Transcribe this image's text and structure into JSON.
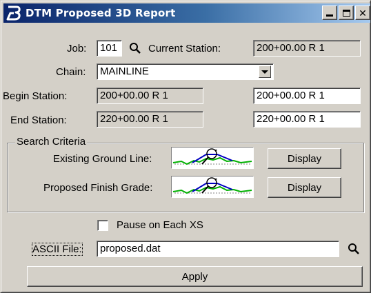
{
  "window": {
    "title": "DTM Proposed 3D Report",
    "icon": "bentley-b-icon",
    "controls": [
      "minimize",
      "maximize",
      "close"
    ]
  },
  "job": {
    "label": "Job:",
    "value": "101",
    "search_icon": "magnifier-icon"
  },
  "current_station": {
    "label": "Current Station:",
    "value": "200+00.00 R 1"
  },
  "chain": {
    "label": "Chain:",
    "value": "MAINLINE"
  },
  "begin_station": {
    "label": "Begin Station:",
    "value": "200+00.00 R 1",
    "input_value": "200+00.00 R 1"
  },
  "end_station": {
    "label": "End Station:",
    "value": "220+00.00 R 1",
    "input_value": "220+00.00 R 1"
  },
  "search_criteria": {
    "title": "Search Criteria",
    "existing": {
      "label": "Existing Ground Line:",
      "button": "Display"
    },
    "proposed": {
      "label": "Proposed Finish Grade:",
      "button": "Display"
    }
  },
  "pause": {
    "label": "Pause on Each XS",
    "checked": false
  },
  "ascii_file": {
    "label": "ASCII File:",
    "value": "proposed.dat"
  },
  "apply_label": "Apply",
  "colors": {
    "title_start": "#0a246a",
    "title_end": "#a6caf0",
    "face": "#d4d0c8",
    "terrain": "#00b000",
    "grade": "#0000c0"
  }
}
